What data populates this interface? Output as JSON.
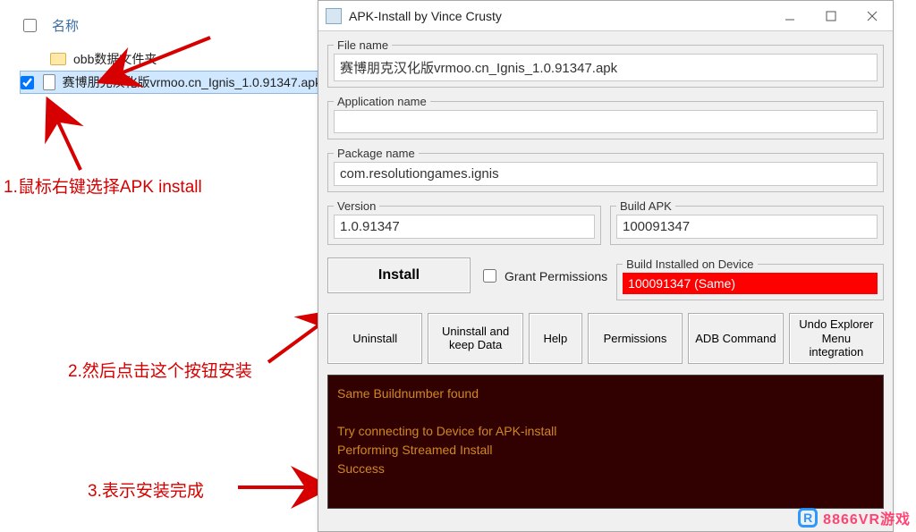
{
  "explorer": {
    "col_name": "名称",
    "folder_label": "obb数据文件夹",
    "file_label": "赛博朋克汉化版vrmoo.cn_Ignis_1.0.91347.apk"
  },
  "annotations": {
    "a1": "1.鼠标右键选择APK install",
    "a2": "2.然后点击这个按钮安装",
    "a3": "3.表示安装完成"
  },
  "dialog": {
    "title": "APK-Install by Vince Crusty",
    "fields": {
      "file_name_label": "File name",
      "file_name_value": "赛博朋克汉化版vrmoo.cn_Ignis_1.0.91347.apk",
      "app_name_label": "Application name",
      "app_name_value": "",
      "pkg_name_label": "Package name",
      "pkg_name_value": "com.resolutiongames.ignis",
      "version_label": "Version",
      "version_value": "1.0.91347",
      "build_apk_label": "Build APK",
      "build_apk_value": "100091347",
      "build_device_label": "Build Installed on Device",
      "build_device_value": "100091347 (Same)"
    },
    "buttons": {
      "install": "Install",
      "grant": "Grant Permissions",
      "uninstall": "Uninstall",
      "uninstall_keep": "Uninstall and keep Data",
      "help": "Help",
      "permissions": "Permissions",
      "adb": "ADB Command",
      "undo": "Undo Explorer Menu integration"
    },
    "console": "Same Buildnumber found\n\nTry connecting to Device for APK-install\nPerforming Streamed Install\nSuccess"
  },
  "watermark": {
    "logo": "R",
    "text": "8866VR游戏"
  }
}
